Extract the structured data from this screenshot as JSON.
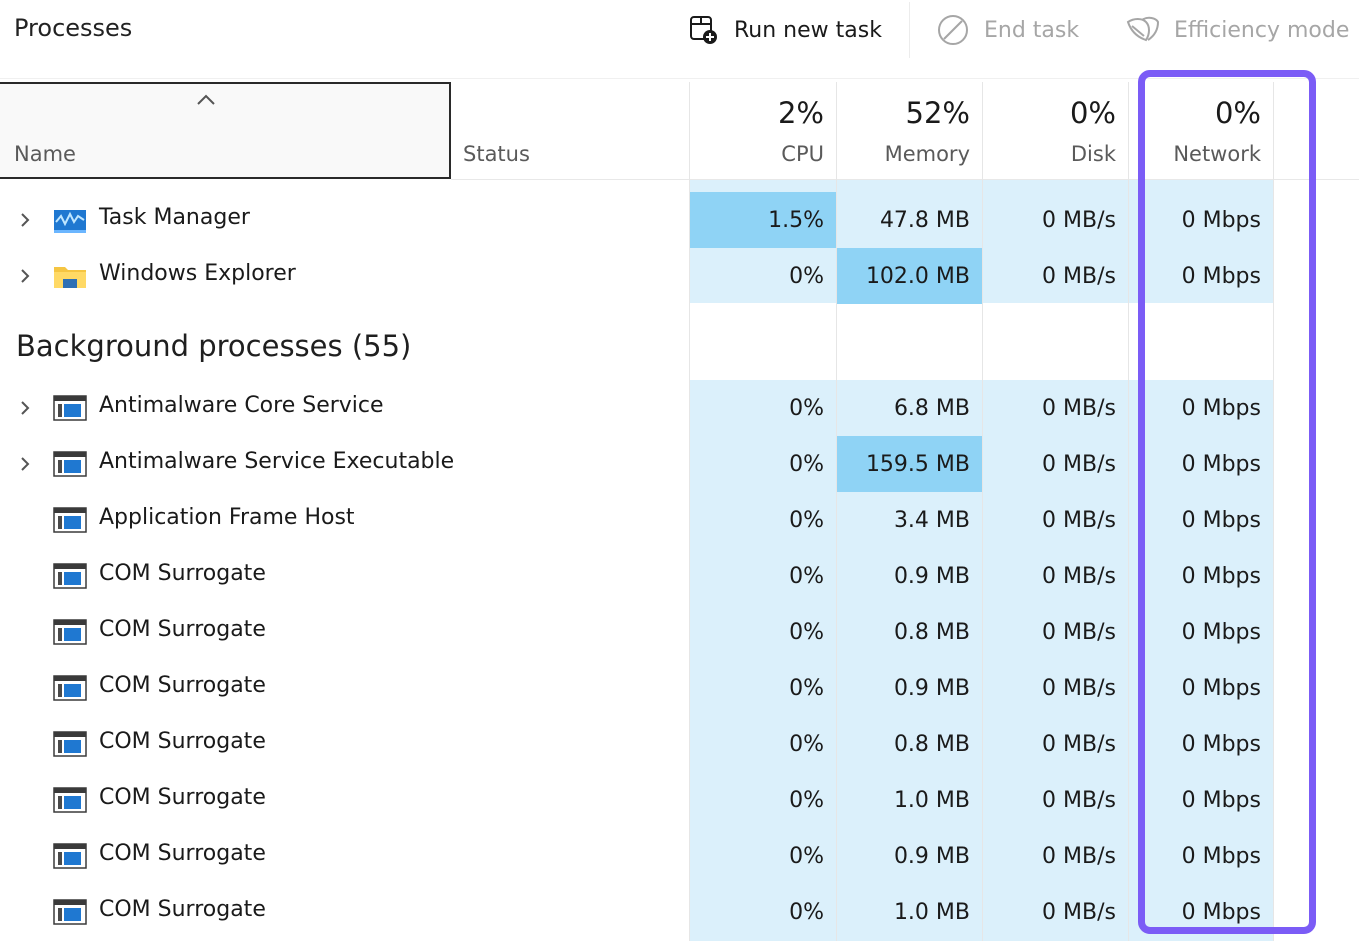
{
  "toolbar": {
    "title": "Processes",
    "run_new_task": "Run new task",
    "end_task": "End task",
    "efficiency_mode": "Efficiency mode"
  },
  "columns": {
    "name": "Name",
    "status": "Status",
    "cpu": {
      "label": "CPU",
      "total": "2%"
    },
    "memory": {
      "label": "Memory",
      "total": "52%"
    },
    "disk": {
      "label": "Disk",
      "total": "0%"
    },
    "network": {
      "label": "Network",
      "total": "0%"
    }
  },
  "apps": [
    {
      "name": "Task Manager",
      "cpu": "1.5%",
      "memory": "47.8 MB",
      "disk": "0 MB/s",
      "network": "0 Mbps",
      "expandable": true,
      "icon": "task-manager-icon"
    },
    {
      "name": "Windows Explorer",
      "cpu": "0%",
      "memory": "102.0 MB",
      "disk": "0 MB/s",
      "network": "0 Mbps",
      "expandable": true,
      "icon": "folder-icon"
    }
  ],
  "background_group": {
    "label": "Background processes (55)"
  },
  "background": [
    {
      "name": "Antimalware Core Service",
      "cpu": "0%",
      "memory": "6.8 MB",
      "disk": "0 MB/s",
      "network": "0 Mbps",
      "expandable": true
    },
    {
      "name": "Antimalware Service Executable",
      "cpu": "0%",
      "memory": "159.5 MB",
      "disk": "0 MB/s",
      "network": "0 Mbps",
      "expandable": true
    },
    {
      "name": "Application Frame Host",
      "cpu": "0%",
      "memory": "3.4 MB",
      "disk": "0 MB/s",
      "network": "0 Mbps",
      "expandable": false
    },
    {
      "name": "COM Surrogate",
      "cpu": "0%",
      "memory": "0.9 MB",
      "disk": "0 MB/s",
      "network": "0 Mbps",
      "expandable": false
    },
    {
      "name": "COM Surrogate",
      "cpu": "0%",
      "memory": "0.8 MB",
      "disk": "0 MB/s",
      "network": "0 Mbps",
      "expandable": false
    },
    {
      "name": "COM Surrogate",
      "cpu": "0%",
      "memory": "0.9 MB",
      "disk": "0 MB/s",
      "network": "0 Mbps",
      "expandable": false
    },
    {
      "name": "COM Surrogate",
      "cpu": "0%",
      "memory": "0.8 MB",
      "disk": "0 MB/s",
      "network": "0 Mbps",
      "expandable": false
    },
    {
      "name": "COM Surrogate",
      "cpu": "0%",
      "memory": "1.0 MB",
      "disk": "0 MB/s",
      "network": "0 Mbps",
      "expandable": false
    },
    {
      "name": "COM Surrogate",
      "cpu": "0%",
      "memory": "0.9 MB",
      "disk": "0 MB/s",
      "network": "0 Mbps",
      "expandable": false
    },
    {
      "name": "COM Surrogate",
      "cpu": "0%",
      "memory": "1.0 MB",
      "disk": "0 MB/s",
      "network": "0 Mbps",
      "expandable": false
    }
  ],
  "colors": {
    "heat_low": "#dbf0fb",
    "heat_mid": "#a9ddf7",
    "heat_high": "#8fd3f5",
    "highlight": "#7b5cf6"
  }
}
